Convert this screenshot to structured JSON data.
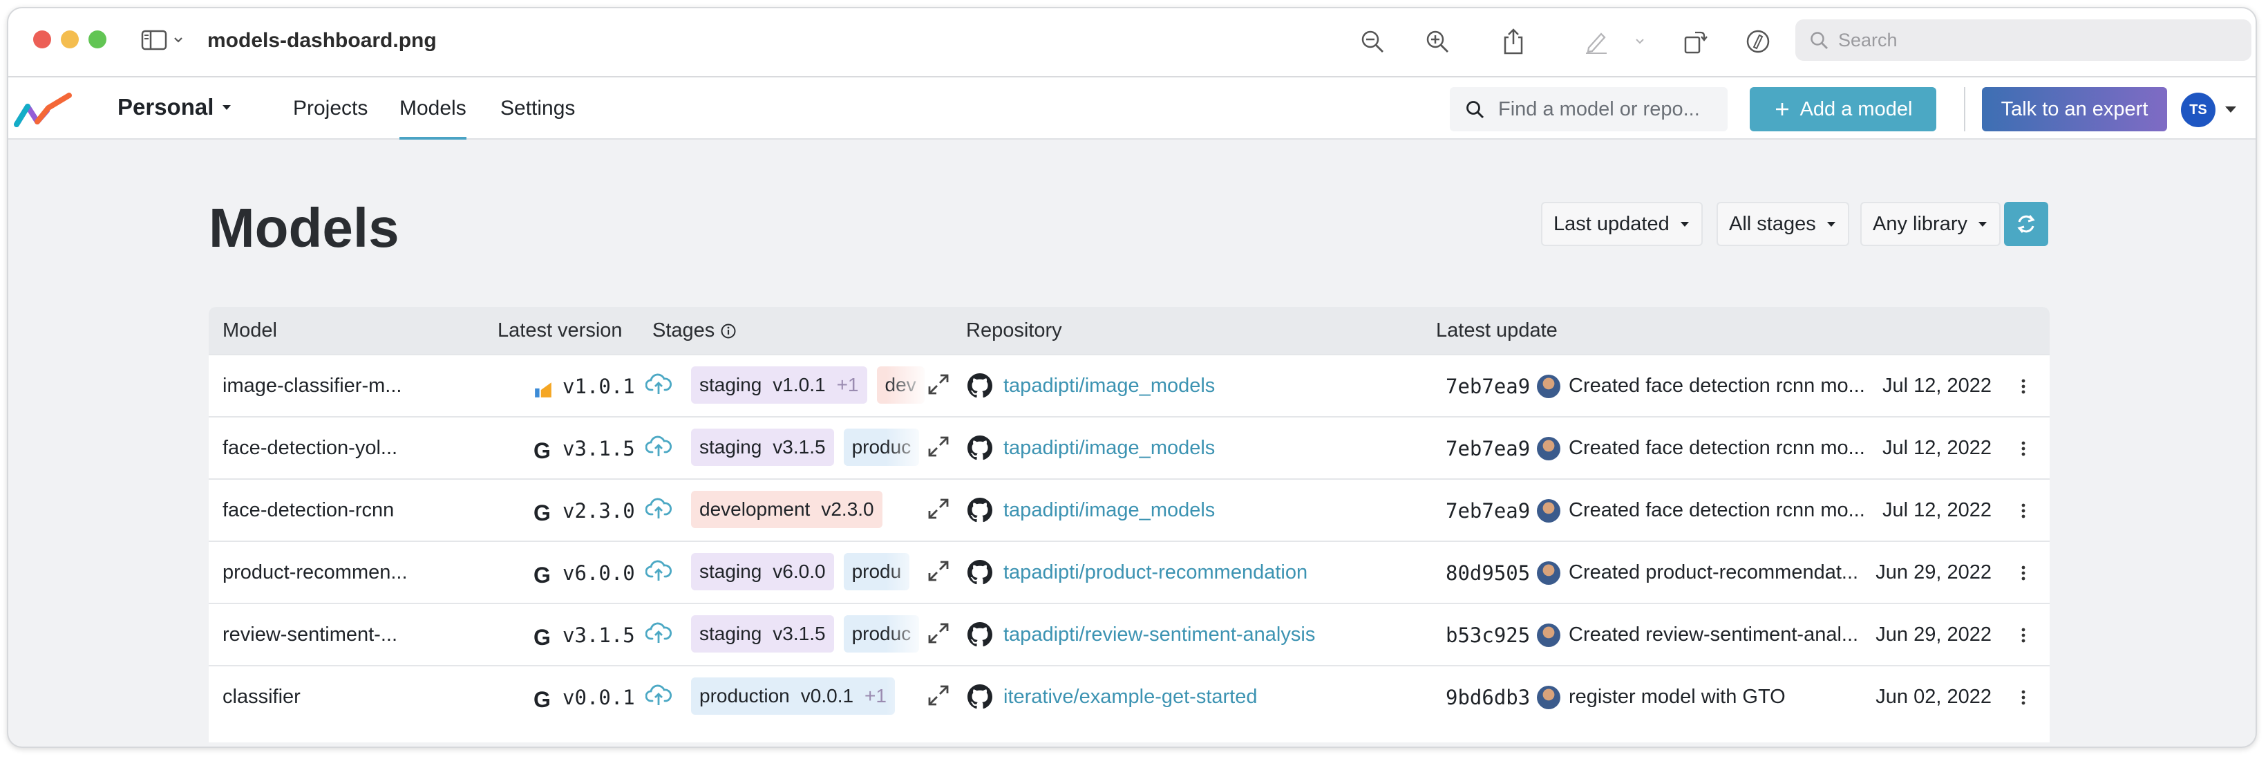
{
  "window": {
    "title": "models-dashboard.png",
    "search_placeholder": "Search",
    "traffic_lights": {
      "close": "#ec5f56",
      "minimize": "#f4bd4f",
      "zoom": "#62c554"
    }
  },
  "appnav": {
    "workspace": "Personal",
    "links": [
      "Projects",
      "Models",
      "Settings"
    ],
    "active_link": "Models",
    "search_placeholder": "Find a model or repo...",
    "add_model_label": "Add a model",
    "expert_label": "Talk to an expert",
    "avatar_initials": "TS",
    "accent_color": "#4ba8c4"
  },
  "page": {
    "title": "Models",
    "filters": [
      "Last updated",
      "All stages",
      "Any library"
    ]
  },
  "table": {
    "headers": [
      "Model",
      "Latest version",
      "Stages",
      "Repository",
      "Latest update"
    ],
    "rows": [
      {
        "name": "image-classifier-m...",
        "lib_icon": "sklearn-icon",
        "version": "v1.0.1",
        "stages": [
          {
            "stage": "staging",
            "version": "v1.0.1",
            "extra": "+1",
            "kind": "staging"
          },
          {
            "stage": "dev",
            "version": "",
            "extra": "",
            "kind": "dev"
          }
        ],
        "repo": "tapadipti/image_models",
        "commit": "7eb7ea9",
        "message": "Created face detection rcnn mo...",
        "date": "Jul 12, 2022"
      },
      {
        "name": "face-detection-yol...",
        "lib_icon": "G",
        "version": "v3.1.5",
        "stages": [
          {
            "stage": "staging",
            "version": "v3.1.5",
            "extra": "",
            "kind": "staging"
          },
          {
            "stage": "produc",
            "version": "",
            "extra": "",
            "kind": "prod"
          }
        ],
        "repo": "tapadipti/image_models",
        "commit": "7eb7ea9",
        "message": "Created face detection rcnn mo...",
        "date": "Jul 12, 2022"
      },
      {
        "name": "face-detection-rcnn",
        "lib_icon": "G",
        "version": "v2.3.0",
        "stages": [
          {
            "stage": "development",
            "version": "v2.3.0",
            "extra": "",
            "kind": "dev"
          }
        ],
        "repo": "tapadipti/image_models",
        "commit": "7eb7ea9",
        "message": "Created face detection rcnn mo...",
        "date": "Jul 12, 2022"
      },
      {
        "name": "product-recommen...",
        "lib_icon": "G",
        "version": "v6.0.0",
        "stages": [
          {
            "stage": "staging",
            "version": "v6.0.0",
            "extra": "",
            "kind": "staging"
          },
          {
            "stage": "produ",
            "version": "",
            "extra": "",
            "kind": "prod"
          }
        ],
        "repo": "tapadipti/product-recommendation",
        "commit": "80d9505",
        "message": "Created product-recommendat...",
        "date": "Jun 29, 2022"
      },
      {
        "name": "review-sentiment-...",
        "lib_icon": "G",
        "version": "v3.1.5",
        "stages": [
          {
            "stage": "staging",
            "version": "v3.1.5",
            "extra": "",
            "kind": "staging"
          },
          {
            "stage": "produc",
            "version": "",
            "extra": "",
            "kind": "prod"
          }
        ],
        "repo": "tapadipti/review-sentiment-analysis",
        "commit": "b53c925",
        "message": "Created review-sentiment-anal...",
        "date": "Jun 29, 2022"
      },
      {
        "name": "classifier",
        "lib_icon": "G",
        "version": "v0.0.1",
        "stages": [
          {
            "stage": "production",
            "version": "v0.0.1",
            "extra": "+1",
            "kind": "prod"
          }
        ],
        "repo": "iterative/example-get-started",
        "commit": "9bd6db3",
        "message": "register model with GTO",
        "date": "Jun 02, 2022"
      }
    ]
  }
}
